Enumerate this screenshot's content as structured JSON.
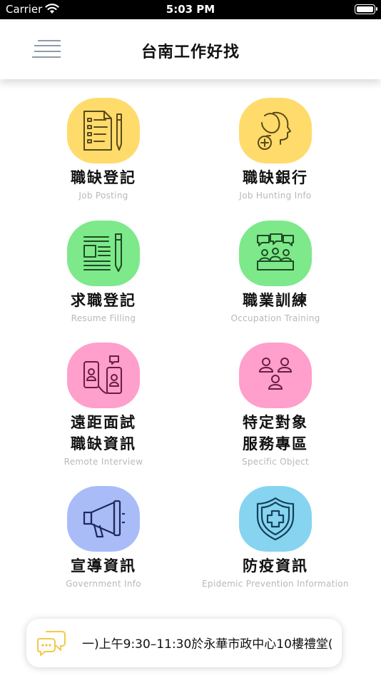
{
  "status_bar": {
    "carrier": "Carrier",
    "time": "5:03 PM"
  },
  "nav": {
    "title": "台南工作好找"
  },
  "tiles": [
    {
      "title": "職缺登記",
      "subtitle": "Job Posting",
      "color": "#FFDB6B",
      "icon": "job-posting-icon"
    },
    {
      "title": "職缺銀行",
      "subtitle": "Job Hunting Info",
      "color": "#FFDB6B",
      "icon": "job-hunting-icon"
    },
    {
      "title": "求職登記",
      "subtitle": "Resume Filling",
      "color": "#7DE98A",
      "icon": "resume-icon"
    },
    {
      "title": "職業訓練",
      "subtitle": "Occupation Training",
      "color": "#7DE98A",
      "icon": "training-icon"
    },
    {
      "title_line1": "遠距面試",
      "title_line2": "職缺資訊",
      "subtitle": "Remote Interview",
      "color": "#FF9FCB",
      "icon": "remote-interview-icon"
    },
    {
      "title_line1": "特定對象",
      "title_line2": "服務專區",
      "subtitle": "Specific Object",
      "color": "#FF9FCB",
      "icon": "specific-object-icon"
    },
    {
      "title": "宣導資訊",
      "subtitle": "Government Info",
      "color": "#A9BCF8",
      "icon": "megaphone-icon"
    },
    {
      "title": "防疫資訊",
      "subtitle": "Epidemic Prevention Information",
      "color": "#86D4F0",
      "icon": "shield-cross-icon"
    }
  ],
  "announcement": {
    "text": "一)上午9:30–11:30於永華市政中心10樓禮堂(",
    "icon": "chat-bubbles-icon"
  }
}
